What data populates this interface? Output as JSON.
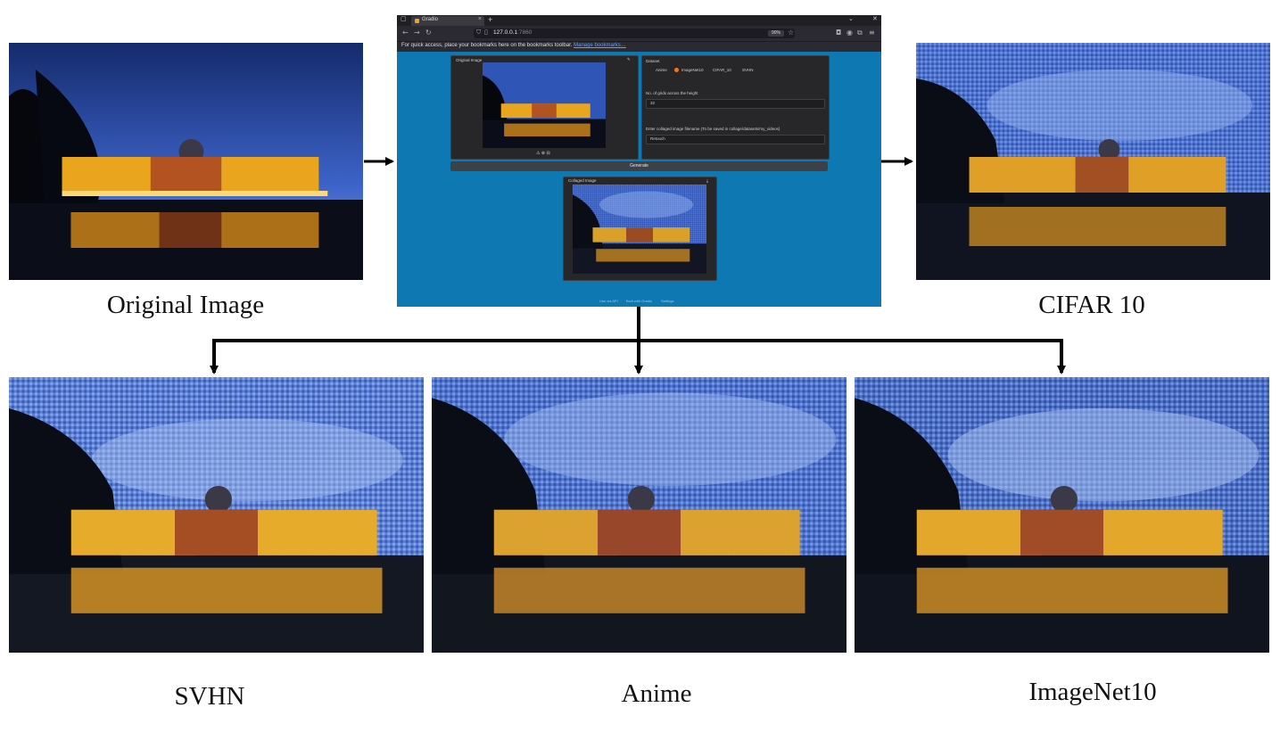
{
  "captions": {
    "original": "Original Image",
    "cifar": "CIFAR 10",
    "svhn": "SVHN",
    "anime": "Anime",
    "imagenet": "ImageNet10"
  },
  "browser": {
    "tab_title": "Gradio",
    "tab_close": "×",
    "new_tab": "+",
    "url_host": "127.0.0.1",
    "url_port": ":7860",
    "zoom": "90%",
    "bookmarks_text": "For quick access, place your bookmarks here on the bookmarks toolbar.",
    "bookmarks_link": "Manage bookmarks…"
  },
  "gradio": {
    "original_image_label": "Original Image",
    "dataset_label": "Dataset",
    "dataset_options": [
      "Anime",
      "ImageNet10",
      "CIFAR_10",
      "SVHN"
    ],
    "dataset_selected": "ImageNet10",
    "grid_label": "No. of grids across the height",
    "grid_value": "32",
    "filename_label": "Enter collaged image filename (To be saved in collage/datasets/my_videos)",
    "filename_value": "Retouch",
    "generate_label": "Generate",
    "collaged_image_label": "Collaged Image",
    "footer": [
      "Use via API",
      "Built with Gradio",
      "Settings"
    ]
  },
  "colors": {
    "browser_bg": "#0e78b3",
    "panel_bg": "#27272a",
    "accent": "#f97316",
    "building_lights": "#f3b92a",
    "sky_dusk": "#2a4ea8"
  }
}
